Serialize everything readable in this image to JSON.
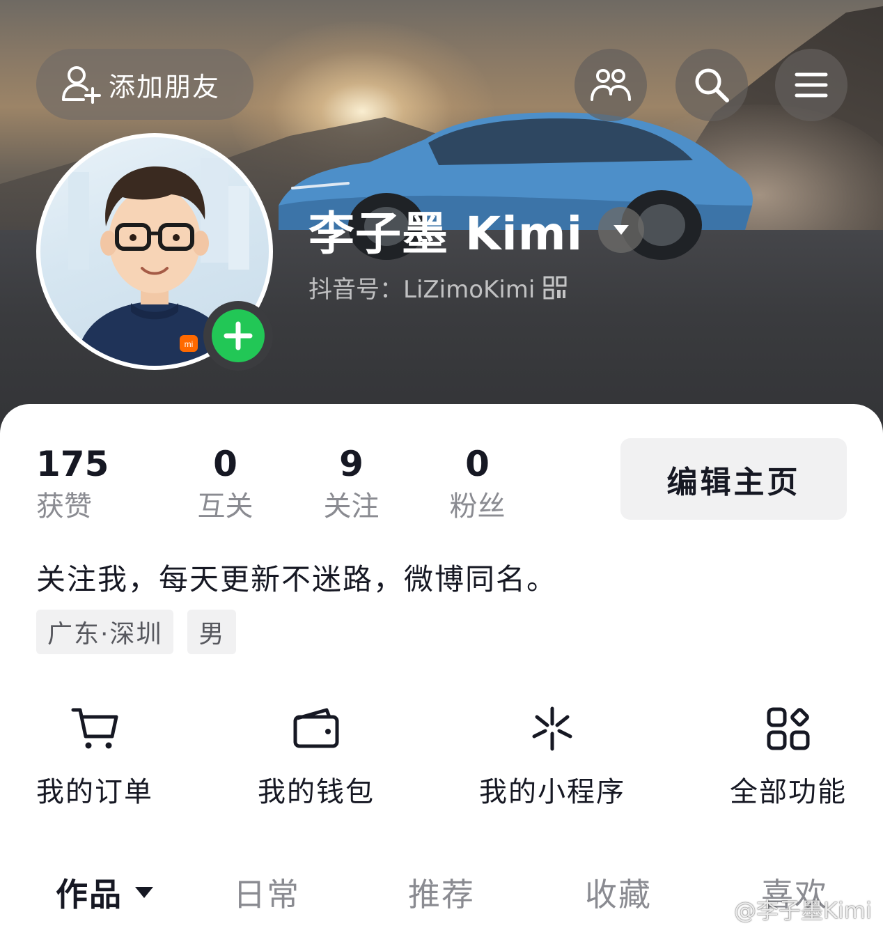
{
  "header": {
    "add_friend_label": "添加朋友",
    "username": "李子墨 Kimi",
    "douyin_id": "抖音号：LiZimoKimi"
  },
  "profile": {
    "stats": [
      {
        "value": "175",
        "label": "获赞"
      },
      {
        "value": "0",
        "label": "互关"
      },
      {
        "value": "9",
        "label": "关注"
      },
      {
        "value": "0",
        "label": "粉丝"
      }
    ],
    "edit_label": "编辑主页",
    "bio": "关注我，每天更新不迷路，微博同名。",
    "tags": [
      "广东·深圳",
      "男"
    ]
  },
  "features": [
    {
      "label": "我的订单",
      "icon": "cart-icon"
    },
    {
      "label": "我的钱包",
      "icon": "wallet-icon"
    },
    {
      "label": "我的小程序",
      "icon": "mini-program-icon"
    },
    {
      "label": "全部功能",
      "icon": "all-features-icon"
    }
  ],
  "tabs": [
    {
      "label": "作品",
      "active": true
    },
    {
      "label": "日常",
      "active": false
    },
    {
      "label": "推荐",
      "active": false
    },
    {
      "label": "收藏",
      "active": false
    },
    {
      "label": "喜欢",
      "active": false
    }
  ],
  "watermark": "@李子墨Kimi",
  "colors": {
    "accent_green": "#22c756",
    "text_primary": "#161823",
    "text_secondary": "#8a8b91",
    "chip_bg": "#f1f1f2",
    "car_blue": "#4d8fc9"
  }
}
